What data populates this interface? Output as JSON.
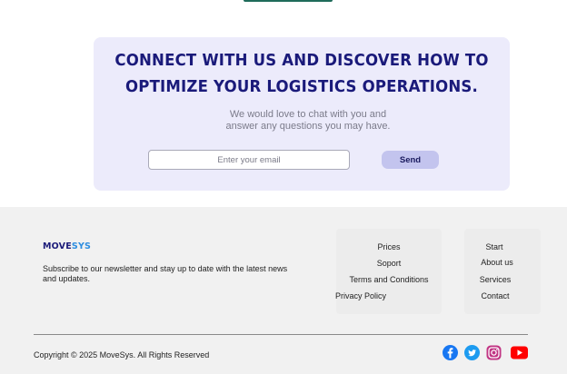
{
  "cta": {
    "title": "Connect with us and discover how to optimize your logistics operations.",
    "subtitle": "We would love to chat with you and answer any questions you may have.",
    "email_placeholder": "Enter your email",
    "send_label": "Send"
  },
  "footer": {
    "logo": {
      "main": "MOVE",
      "accent": "SYS"
    },
    "newsletter_text": "Subscribe to our newsletter and stay up to date with the latest news and updates.",
    "links_col1": [
      "Prices",
      "Soport",
      "Terms and Conditions",
      "Privacy Policy"
    ],
    "links_col2": [
      "Start",
      "About us",
      "Services",
      "Contact"
    ],
    "copyright": "Copyright © 2025 MoveSys. All Rights Reserved",
    "social_icons": [
      "facebook-icon",
      "twitter-icon",
      "instagram-icon",
      "youtube-icon"
    ]
  },
  "colors": {
    "title": "#1a1a7a",
    "cta_bg": "#ecebfb",
    "send_bg": "#c3c4ee",
    "footer_bg": "#f1f1f1"
  }
}
